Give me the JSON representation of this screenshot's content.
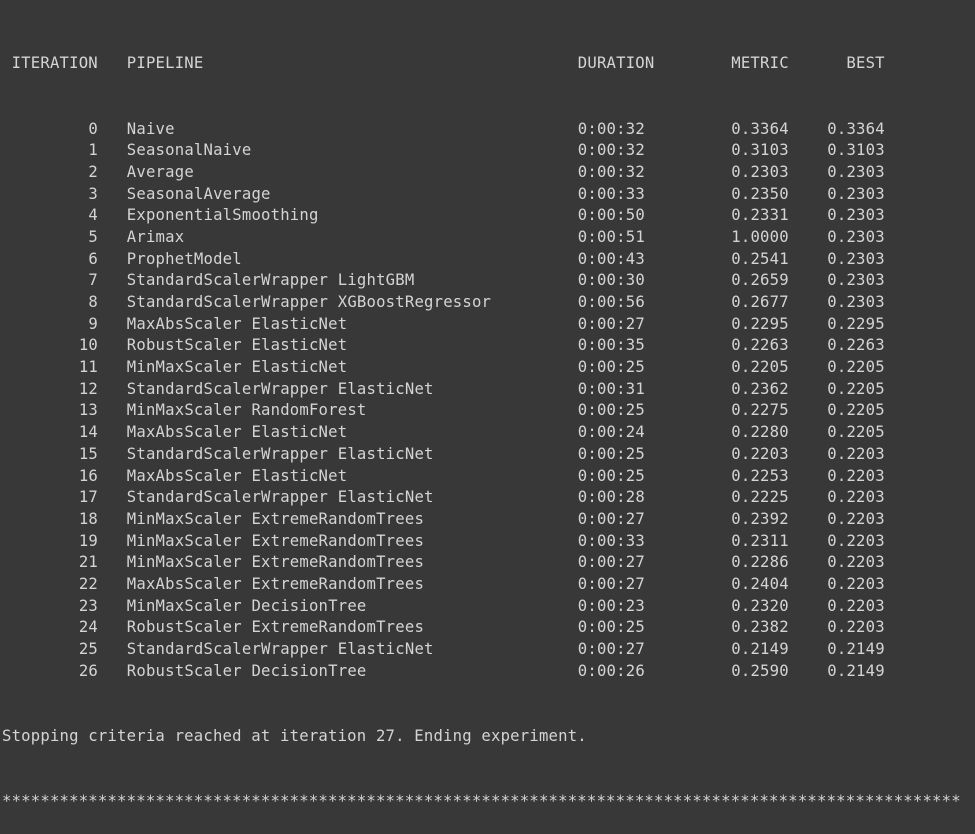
{
  "table": {
    "headers": {
      "iteration": "ITERATION",
      "pipeline": "PIPELINE",
      "duration": "DURATION",
      "metric": "METRIC",
      "best": "BEST"
    },
    "rows": [
      {
        "iteration": "0",
        "pipeline": "Naive",
        "duration": "0:00:32",
        "metric": "0.3364",
        "best": "0.3364"
      },
      {
        "iteration": "1",
        "pipeline": "SeasonalNaive",
        "duration": "0:00:32",
        "metric": "0.3103",
        "best": "0.3103"
      },
      {
        "iteration": "2",
        "pipeline": "Average",
        "duration": "0:00:32",
        "metric": "0.2303",
        "best": "0.2303"
      },
      {
        "iteration": "3",
        "pipeline": "SeasonalAverage",
        "duration": "0:00:33",
        "metric": "0.2350",
        "best": "0.2303"
      },
      {
        "iteration": "4",
        "pipeline": "ExponentialSmoothing",
        "duration": "0:00:50",
        "metric": "0.2331",
        "best": "0.2303"
      },
      {
        "iteration": "5",
        "pipeline": "Arimax",
        "duration": "0:00:51",
        "metric": "1.0000",
        "best": "0.2303"
      },
      {
        "iteration": "6",
        "pipeline": "ProphetModel",
        "duration": "0:00:43",
        "metric": "0.2541",
        "best": "0.2303"
      },
      {
        "iteration": "7",
        "pipeline": "StandardScalerWrapper LightGBM",
        "duration": "0:00:30",
        "metric": "0.2659",
        "best": "0.2303"
      },
      {
        "iteration": "8",
        "pipeline": "StandardScalerWrapper XGBoostRegressor",
        "duration": "0:00:56",
        "metric": "0.2677",
        "best": "0.2303"
      },
      {
        "iteration": "9",
        "pipeline": "MaxAbsScaler ElasticNet",
        "duration": "0:00:27",
        "metric": "0.2295",
        "best": "0.2295"
      },
      {
        "iteration": "10",
        "pipeline": "RobustScaler ElasticNet",
        "duration": "0:00:35",
        "metric": "0.2263",
        "best": "0.2263"
      },
      {
        "iteration": "11",
        "pipeline": "MinMaxScaler ElasticNet",
        "duration": "0:00:25",
        "metric": "0.2205",
        "best": "0.2205"
      },
      {
        "iteration": "12",
        "pipeline": "StandardScalerWrapper ElasticNet",
        "duration": "0:00:31",
        "metric": "0.2362",
        "best": "0.2205"
      },
      {
        "iteration": "13",
        "pipeline": "MinMaxScaler RandomForest",
        "duration": "0:00:25",
        "metric": "0.2275",
        "best": "0.2205"
      },
      {
        "iteration": "14",
        "pipeline": "MaxAbsScaler ElasticNet",
        "duration": "0:00:24",
        "metric": "0.2280",
        "best": "0.2205"
      },
      {
        "iteration": "15",
        "pipeline": "StandardScalerWrapper ElasticNet",
        "duration": "0:00:25",
        "metric": "0.2203",
        "best": "0.2203"
      },
      {
        "iteration": "16",
        "pipeline": "MaxAbsScaler ElasticNet",
        "duration": "0:00:25",
        "metric": "0.2253",
        "best": "0.2203"
      },
      {
        "iteration": "17",
        "pipeline": "StandardScalerWrapper ElasticNet",
        "duration": "0:00:28",
        "metric": "0.2225",
        "best": "0.2203"
      },
      {
        "iteration": "18",
        "pipeline": "MinMaxScaler ExtremeRandomTrees",
        "duration": "0:00:27",
        "metric": "0.2392",
        "best": "0.2203"
      },
      {
        "iteration": "19",
        "pipeline": "MinMaxScaler ExtremeRandomTrees",
        "duration": "0:00:33",
        "metric": "0.2311",
        "best": "0.2203"
      },
      {
        "iteration": "21",
        "pipeline": "MinMaxScaler ExtremeRandomTrees",
        "duration": "0:00:27",
        "metric": "0.2286",
        "best": "0.2203"
      },
      {
        "iteration": "22",
        "pipeline": "MaxAbsScaler ExtremeRandomTrees",
        "duration": "0:00:27",
        "metric": "0.2404",
        "best": "0.2203"
      },
      {
        "iteration": "23",
        "pipeline": "MinMaxScaler DecisionTree",
        "duration": "0:00:23",
        "metric": "0.2320",
        "best": "0.2203"
      },
      {
        "iteration": "24",
        "pipeline": "RobustScaler ExtremeRandomTrees",
        "duration": "0:00:25",
        "metric": "0.2382",
        "best": "0.2203"
      },
      {
        "iteration": "25",
        "pipeline": "StandardScalerWrapper ElasticNet",
        "duration": "0:00:27",
        "metric": "0.2149",
        "best": "0.2149"
      },
      {
        "iteration": "26",
        "pipeline": "RobustScaler DecisionTree",
        "duration": "0:00:26",
        "metric": "0.2590",
        "best": "0.2149"
      }
    ]
  },
  "footer": {
    "message": "Stopping criteria reached at iteration 27. Ending experiment.",
    "separator": "****************************************************************************************************"
  }
}
